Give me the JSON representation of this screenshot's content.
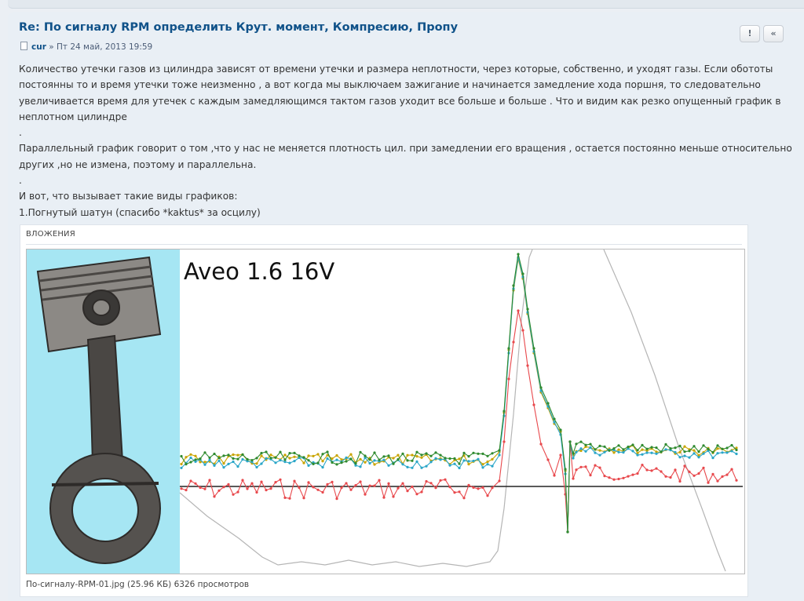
{
  "post": {
    "title": "Re: По сигналу RPM определить Крут. момент, Компресию, Пропу",
    "author": "cur",
    "meta_sep": " » ",
    "date": "Пт 24 май, 2013 19:59",
    "buttons": {
      "report": "!",
      "quote": "«"
    },
    "paragraphs": [
      "Количество утечки газов из цилиндра зависят от времени утечки и размера неплотности, через которые, собственно, и уходят газы. Если обототы постоянны то и время утечки тоже неизменно , а вот когда мы выключаем зажигание и начинается замедление хода поршня, то следовательно увеличивается время для утечек с каждым замедляющимся тактом газов уходит все больше и больше . Что и видим как резко опущенный график в неплотном цилиндре",
      ".",
      "Параллельный график говорит о том ,что у нас не меняется плотность цил. при замедлении его вращения , остается постоянно меньше относительно других ,но не измена, поэтому и параллельна.",
      ".",
      "И вот, что вызывает такие виды графиков:",
      "1.Погнутый шатун (спасибо *kaktus* за осцилу)"
    ]
  },
  "attachment": {
    "header": "ВЛОЖЕНИЯ",
    "image_title": "Aveo 1.6 16V",
    "caption": "По-сигналу-RPM-01.jpg (25.96 КБ) 6326 просмотров"
  },
  "colors": {
    "title": "#105289",
    "series_green": "#2f8a2f",
    "series_cyan": "#2aa6c8",
    "series_yellow": "#c9a400",
    "series_red": "#e8484c",
    "series_grey": "#b5b5b5",
    "baseline": "#222222",
    "photo_bg": "#a6e6f3"
  }
}
